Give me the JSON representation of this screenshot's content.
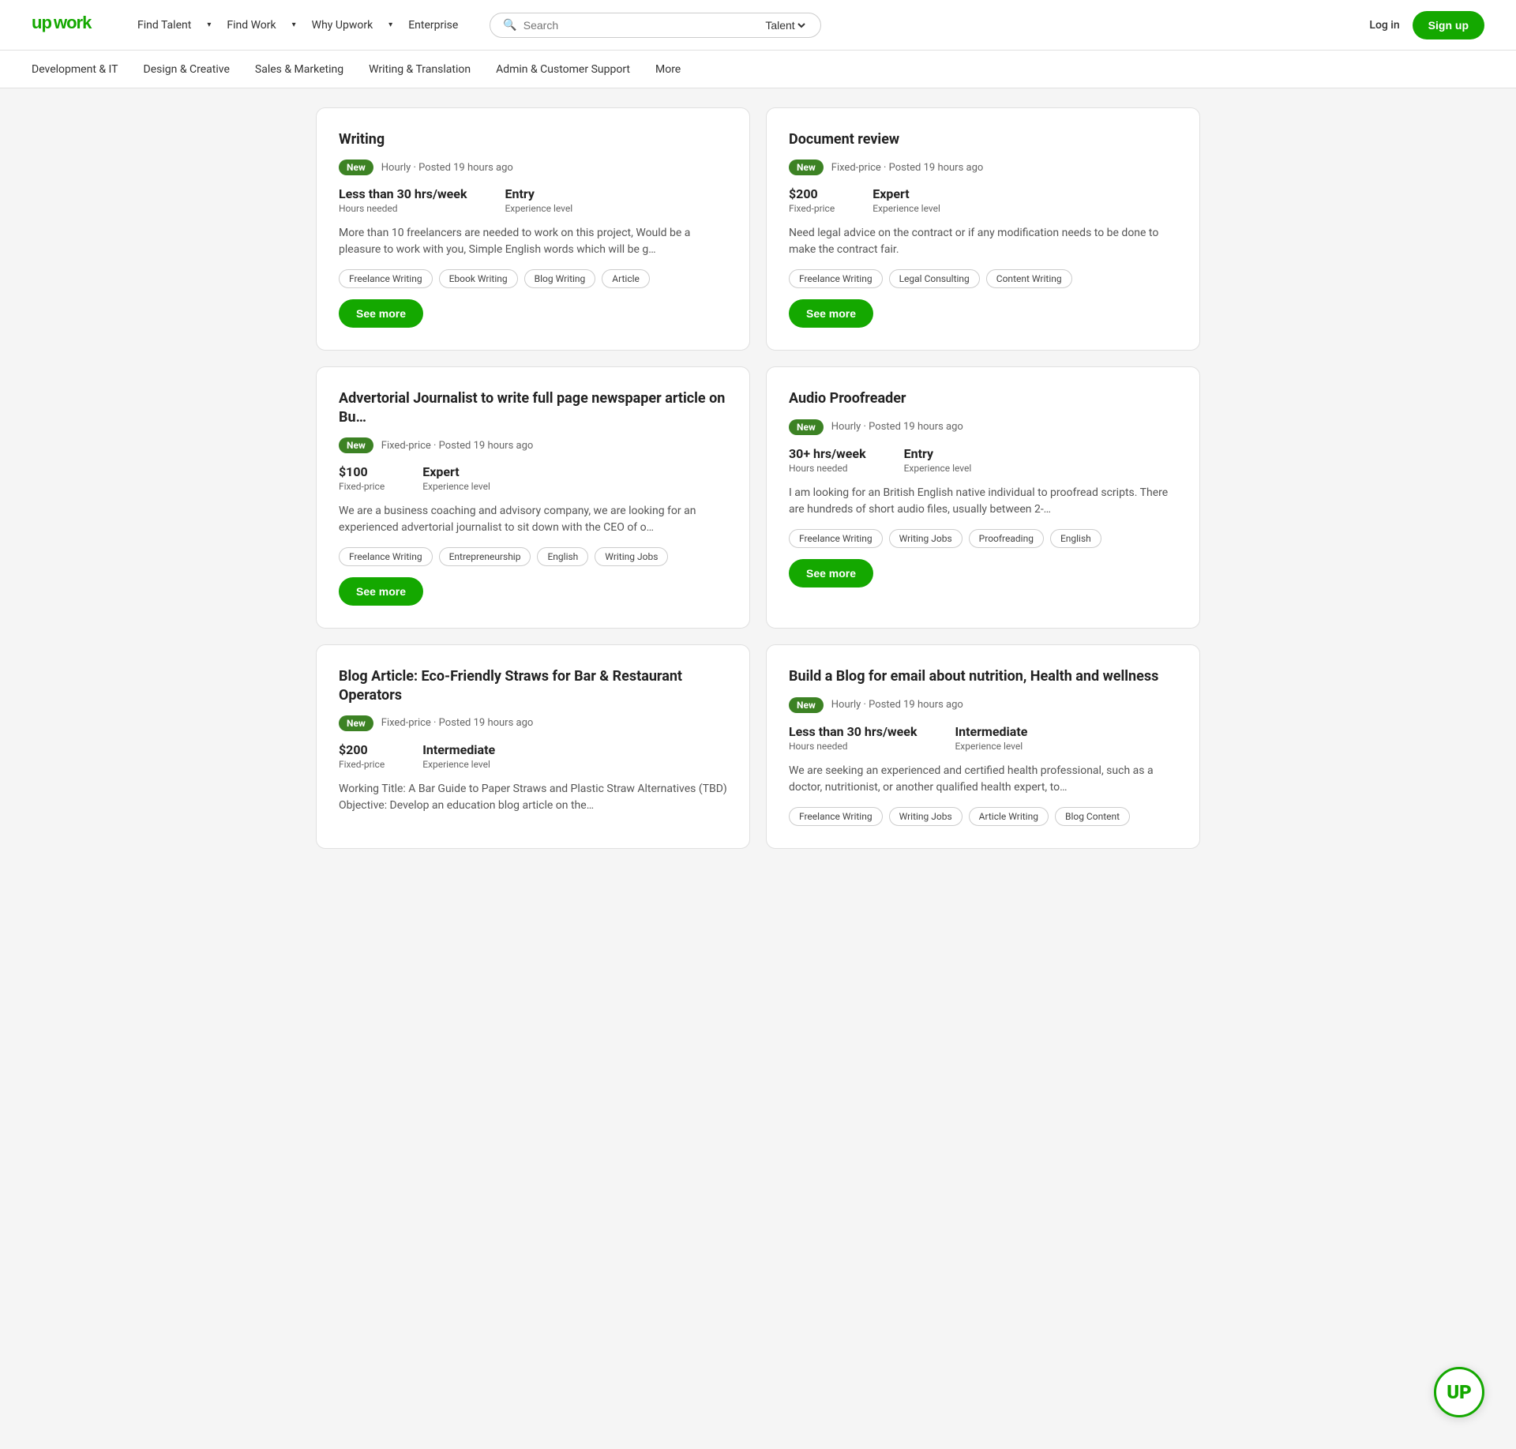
{
  "brand": {
    "logo": "upwork",
    "logo_color": "#14a800"
  },
  "header": {
    "nav": [
      {
        "label": "Find Talent",
        "has_dropdown": true
      },
      {
        "label": "Find Work",
        "has_dropdown": true
      },
      {
        "label": "Why Upwork",
        "has_dropdown": true
      },
      {
        "label": "Enterprise",
        "has_dropdown": false
      }
    ],
    "search": {
      "placeholder": "Search",
      "talent_label": "Talent"
    },
    "login_label": "Log in",
    "signup_label": "Sign up"
  },
  "sub_nav": {
    "items": [
      {
        "label": "Development & IT"
      },
      {
        "label": "Design & Creative"
      },
      {
        "label": "Sales & Marketing"
      },
      {
        "label": "Writing & Translation"
      },
      {
        "label": "Admin & Customer Support"
      },
      {
        "label": "More"
      }
    ]
  },
  "cards": [
    {
      "id": "writing",
      "title": "Writing",
      "badge": "New",
      "meta": "Hourly · Posted 19 hours ago",
      "stats": [
        {
          "value": "Less than 30 hrs/week",
          "label": "Hours needed"
        },
        {
          "value": "Entry",
          "label": "Experience level"
        }
      ],
      "description": "More than 10 freelancers are needed to work on this project, Would be a pleasure to work with you, Simple English words which will be g…",
      "tags": [
        "Freelance Writing",
        "Ebook Writing",
        "Blog Writing",
        "Article"
      ],
      "see_more": "See more"
    },
    {
      "id": "document-review",
      "title": "Document review",
      "badge": "New",
      "meta": "Fixed-price · Posted 19 hours ago",
      "stats": [
        {
          "value": "$200",
          "label": "Fixed-price"
        },
        {
          "value": "Expert",
          "label": "Experience level"
        }
      ],
      "description": "Need legal advice on the contract or if any modification needs to be done to make the contract fair.",
      "tags": [
        "Freelance Writing",
        "Legal Consulting",
        "Content Writing"
      ],
      "see_more": "See more"
    },
    {
      "id": "advertorial-journalist",
      "title": "Advertorial Journalist to write full page newspaper article on Bu…",
      "badge": "New",
      "meta": "Fixed-price · Posted 19 hours ago",
      "stats": [
        {
          "value": "$100",
          "label": "Fixed-price"
        },
        {
          "value": "Expert",
          "label": "Experience level"
        }
      ],
      "description": "We are a business coaching and advisory company, we are looking for an experienced advertorial journalist to sit down with the CEO of o…",
      "tags": [
        "Freelance Writing",
        "Entrepreneurship",
        "English",
        "Writing Jobs"
      ],
      "see_more": "See more"
    },
    {
      "id": "audio-proofreader",
      "title": "Audio Proofreader",
      "badge": "New",
      "meta": "Hourly · Posted 19 hours ago",
      "stats": [
        {
          "value": "30+ hrs/week",
          "label": "Hours needed"
        },
        {
          "value": "Entry",
          "label": "Experience level"
        }
      ],
      "description": "I am looking for an British English native individual to proofread scripts. There are hundreds of short audio files, usually between 2-…",
      "tags": [
        "Freelance Writing",
        "Writing Jobs",
        "Proofreading",
        "English"
      ],
      "see_more": "See more"
    },
    {
      "id": "blog-article-eco-friendly",
      "title": "Blog Article: Eco-Friendly Straws for Bar & Restaurant Operators",
      "badge": "New",
      "meta": "Fixed-price · Posted 19 hours ago",
      "stats": [
        {
          "value": "$200",
          "label": "Fixed-price"
        },
        {
          "value": "Intermediate",
          "label": "Experience level"
        }
      ],
      "description": "Working Title: A Bar Guide to Paper Straws and Plastic Straw Alternatives (TBD) Objective: Develop an education blog article on the…",
      "tags": [],
      "see_more": null
    },
    {
      "id": "build-blog-nutrition",
      "title": "Build a Blog for email about nutrition, Health and wellness",
      "badge": "New",
      "meta": "Hourly · Posted 19 hours ago",
      "stats": [
        {
          "value": "Less than 30 hrs/week",
          "label": "Hours needed"
        },
        {
          "value": "Intermediate",
          "label": "Experience level"
        }
      ],
      "description": "We are seeking an experienced and certified health professional, such as a doctor, nutritionist, or another qualified health expert, to…",
      "tags": [
        "Freelance Writing",
        "Writing Jobs",
        "Article Writing",
        "Blog Content"
      ],
      "see_more": null
    }
  ]
}
